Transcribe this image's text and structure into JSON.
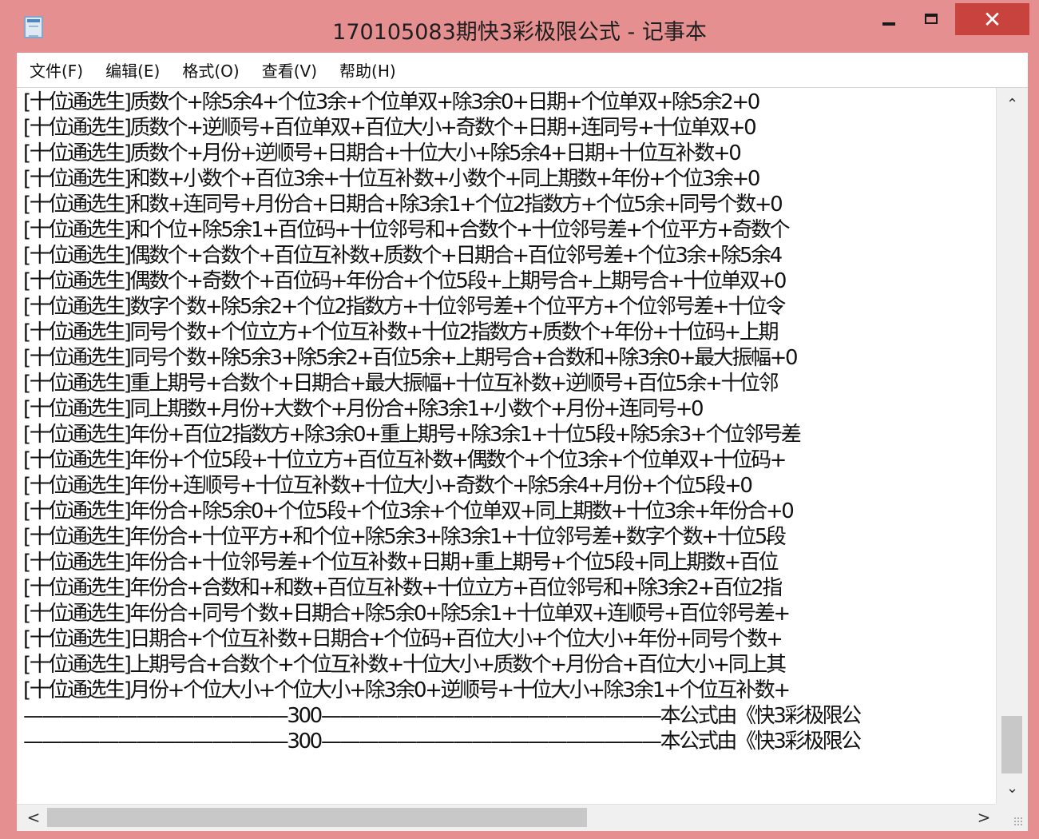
{
  "window": {
    "title": "170105083期快3彩极限公式 - 记事本",
    "minimize_glyph": "",
    "maximize_glyph": "",
    "close_glyph": "✕"
  },
  "menu": {
    "items": [
      {
        "label": "文件(F)"
      },
      {
        "label": "编辑(E)"
      },
      {
        "label": "格式(O)"
      },
      {
        "label": "查看(V)"
      },
      {
        "label": "帮助(H)"
      }
    ]
  },
  "editor": {
    "lines": [
      "[十位通选生]质数个+除5余4+个位3余+个位单双+除3余0+日期+个位单双+除5余2+0",
      "[十位通选生]质数个+逆顺号+百位单双+百位大小+奇数个+日期+连同号+十位单双+0",
      "[十位通选生]质数个+月份+逆顺号+日期合+十位大小+除5余4+日期+十位互补数+0",
      "[十位通选生]和数+小数个+百位3余+十位互补数+小数个+同上期数+年份+个位3余+0",
      "[十位通选生]和数+连同号+月份合+日期合+除3余1+个位2指数方+个位5余+同号个数+0",
      "[十位通选生]和个位+除5余1+百位码+十位邻号和+合数个+十位邻号差+个位平方+奇数个",
      "[十位通选生]偶数个+合数个+百位互补数+质数个+日期合+百位邻号差+个位3余+除5余4",
      "[十位通选生]偶数个+奇数个+百位码+年份合+个位5段+上期号合+上期号合+十位单双+0",
      "[十位通选生]数字个数+除5余2+个位2指数方+十位邻号差+个位平方+个位邻号差+十位令",
      "[十位通选生]同号个数+个位立方+个位互补数+十位2指数方+质数个+年份+十位码+上期",
      "[十位通选生]同号个数+除5余3+除5余2+百位5余+上期号合+合数和+除3余0+最大振幅+0",
      "[十位通选生]重上期号+合数个+日期合+最大振幅+十位互补数+逆顺号+百位5余+十位邻",
      "[十位通选生]同上期数+月份+大数个+月份合+除3余1+小数个+月份+连同号+0",
      "[十位通选生]年份+百位2指数方+除3余0+重上期号+除3余1+十位5段+除5余3+个位邻号差",
      "[十位通选生]年份+个位5段+十位立方+百位互补数+偶数个+个位3余+个位单双+十位码+",
      "[十位通选生]年份+连顺号+十位互补数+十位大小+奇数个+除5余4+月份+个位5段+0",
      "[十位通选生]年份合+除5余0+个位5段+个位3余+个位单双+同上期数+十位3余+年份合+0",
      "[十位通选生]年份合+十位平方+和个位+除5余3+除3余1+十位邻号差+数字个数+十位5段",
      "[十位通选生]年份合+十位邻号差+个位互补数+日期+重上期号+个位5段+同上期数+百位",
      "[十位通选生]年份合+合数和+和数+百位互补数+十位立方+百位邻号和+除3余2+百位2指",
      "[十位通选生]年份合+同号个数+日期合+除5余0+除5余1+十位单双+连顺号+百位邻号差+",
      "[十位通选生]日期合+个位互补数+日期合+个位码+百位大小+个位大小+年份+同号个数+",
      "[十位通选生]上期号合+合数个+个位互补数+十位大小+质数个+月份合+百位大小+同上其",
      "[十位通选生]月份+个位大小+个位大小+除3余0+逆顺号+十位大小+除3余1+个位互补数+",
      "——————————————300——————————————————本公式由《快3彩极限公",
      "——————————————300——————————————————本公式由《快3彩极限公"
    ]
  },
  "scrollbars": {
    "up_glyph": "⌃",
    "down_glyph": "⌄",
    "left_glyph": "<",
    "right_glyph": ">"
  }
}
